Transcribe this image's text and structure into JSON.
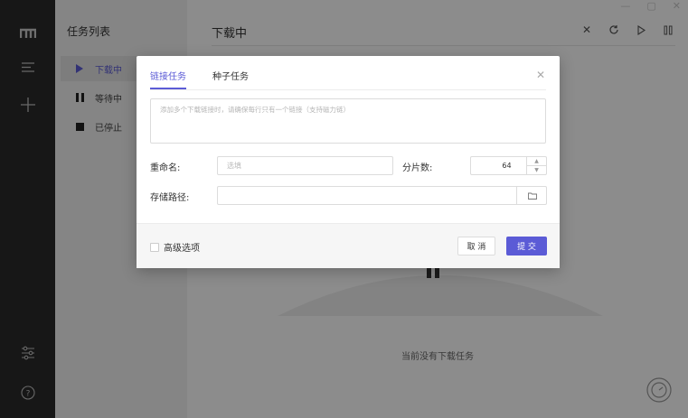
{
  "sidebar": {
    "title": "任务列表",
    "items": [
      {
        "label": "下载中",
        "icon": "play-icon",
        "active": true
      },
      {
        "label": "等待中",
        "icon": "pause-icon",
        "active": false
      },
      {
        "label": "已停止",
        "icon": "stop-icon",
        "active": false
      }
    ]
  },
  "rail": {
    "icons": [
      "logo-icon",
      "menu-icon",
      "add-icon",
      "settings-sliders-icon",
      "help-icon"
    ]
  },
  "main": {
    "title": "下载中",
    "toolbar": [
      "close-icon",
      "refresh-icon",
      "play-icon",
      "pause-icon"
    ],
    "empty_text": "当前没有下载任务"
  },
  "dialog": {
    "tabs": [
      {
        "label": "链接任务",
        "active": true
      },
      {
        "label": "种子任务",
        "active": false
      }
    ],
    "url_placeholder": "添加多个下载链接时，请确保每行只有一个链接（支持磁力链）",
    "rename_label": "重命名:",
    "rename_placeholder": "选填",
    "split_label": "分片数:",
    "split_value": "64",
    "path_label": "存储路径:",
    "path_value": "",
    "advanced_label": "高级选项",
    "cancel_label": "取 消",
    "submit_label": "提 交"
  },
  "colors": {
    "accent": "#5b5bd6",
    "rail_bg": "#2b2b2b",
    "tasklist_bg": "#f3f3f3"
  }
}
